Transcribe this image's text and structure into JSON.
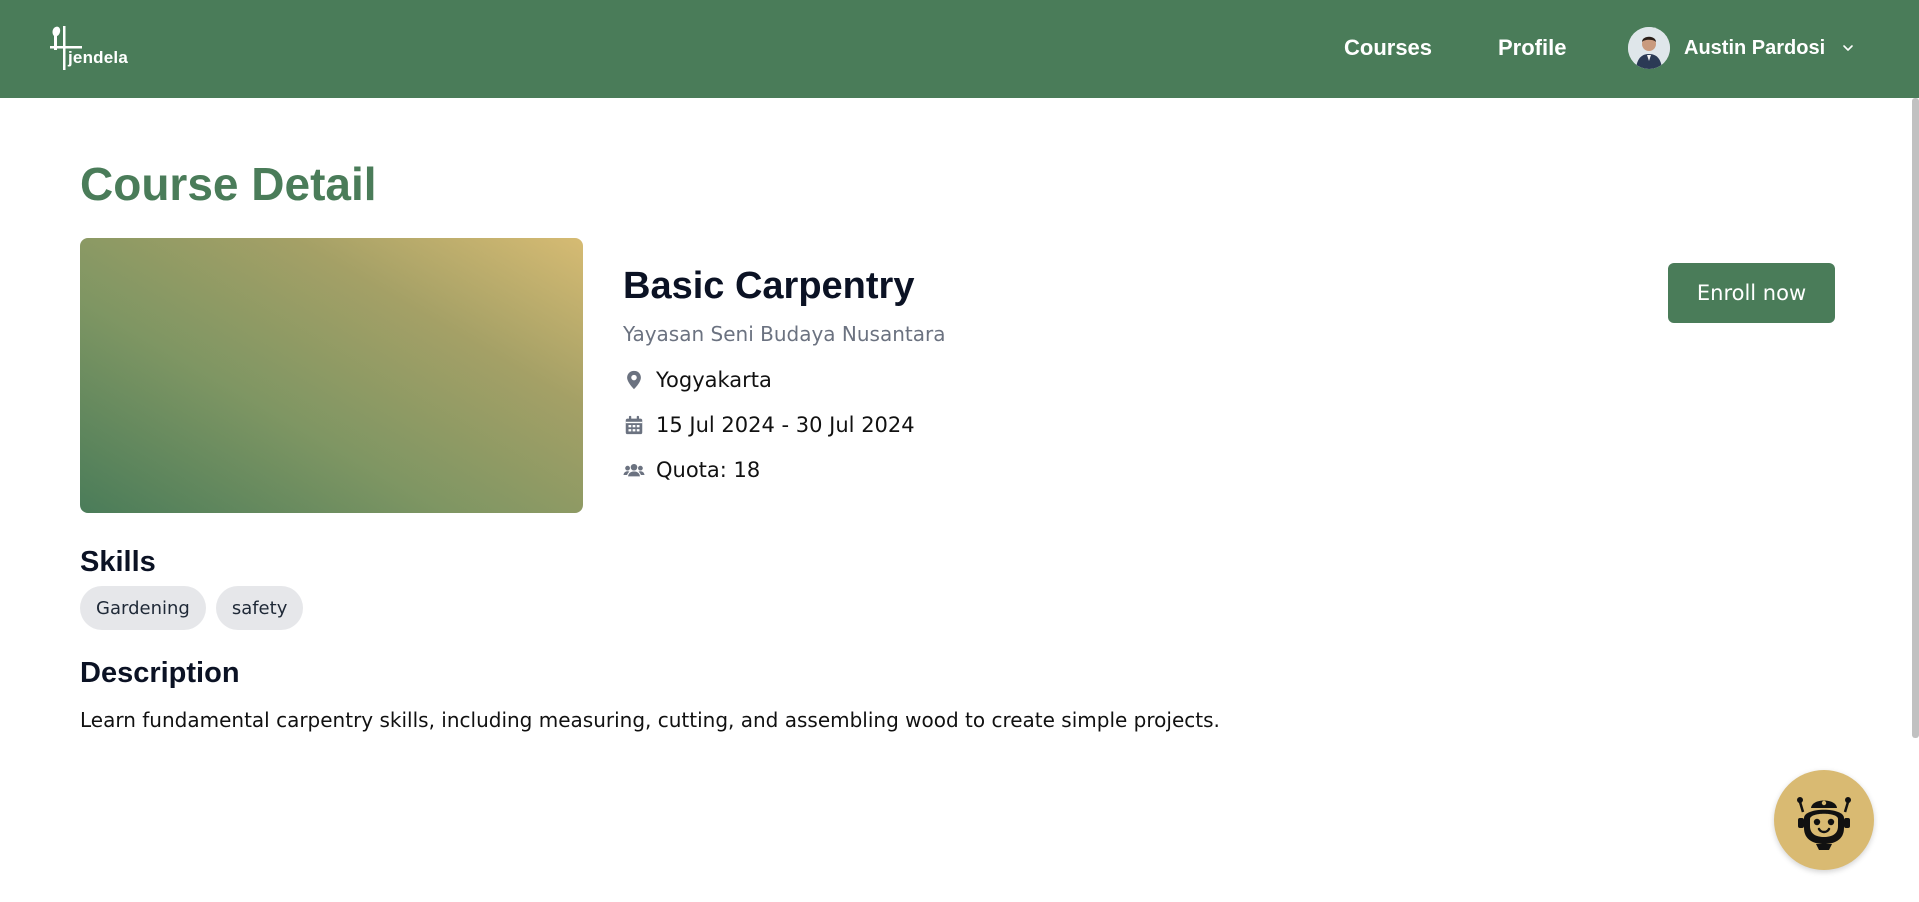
{
  "header": {
    "logo_text": "jendela",
    "nav": {
      "courses": "Courses",
      "profile": "Profile"
    },
    "user": {
      "name": "Austin Pardosi"
    }
  },
  "main": {
    "page_title": "Course Detail",
    "course": {
      "title": "Basic Carpentry",
      "organizer": "Yayasan Seni Budaya Nusantara",
      "location": "Yogyakarta",
      "dates": "15 Jul 2024 - 30 Jul 2024",
      "quota": "Quota: 18"
    },
    "enroll_label": "Enroll now",
    "skills_heading": "Skills",
    "skills": [
      "Gardening",
      "safety"
    ],
    "description_heading": "Description",
    "description": "Learn fundamental carpentry skills, including measuring, cutting, and assembling wood to create simple projects."
  },
  "colors": {
    "primary": "#4a7c59",
    "accent": "#d9ba72",
    "muted_text": "#6b7280",
    "chip_bg": "#e6e7ea"
  },
  "icons": {
    "location": "map-pin-icon",
    "dates": "calendar-icon",
    "quota": "users-icon",
    "chatbot": "robot-icon",
    "user_menu": "chevron-down-icon"
  }
}
